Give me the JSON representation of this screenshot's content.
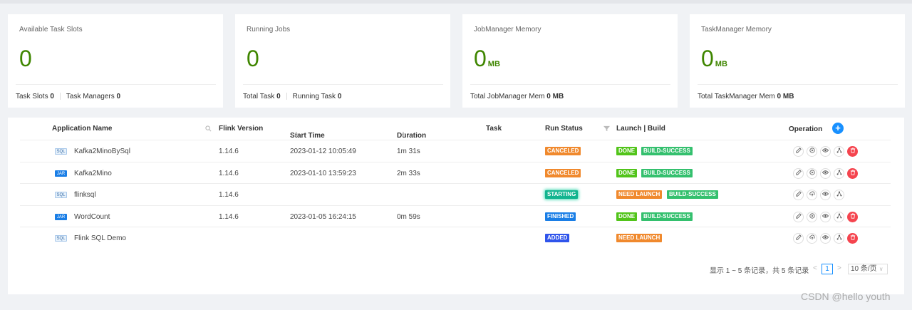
{
  "stats": [
    {
      "title": "Available Task Slots",
      "value": "0",
      "unit": "",
      "footer": [
        {
          "label": "Task Slots",
          "value": "0"
        },
        {
          "label": "Task Managers",
          "value": "0"
        }
      ]
    },
    {
      "title": "Running Jobs",
      "value": "0",
      "unit": "",
      "footer": [
        {
          "label": "Total Task",
          "value": "0"
        },
        {
          "label": "Running Task",
          "value": "0"
        }
      ]
    },
    {
      "title": "JobManager Memory",
      "value": "0",
      "unit": "MB",
      "footer": [
        {
          "label": "Total JobManager Mem",
          "value": "0 MB"
        }
      ]
    },
    {
      "title": "TaskManager Memory",
      "value": "0",
      "unit": "MB",
      "footer": [
        {
          "label": "Total TaskManager Mem",
          "value": "0 MB"
        }
      ]
    }
  ],
  "table": {
    "columns": {
      "name": "Application Name",
      "flink": "Flink Version",
      "start": "Start Time",
      "duration": "Duration",
      "task": "Task",
      "status": "Run Status",
      "launch": "Launch | Build",
      "operation": "Operation"
    },
    "add_icon": "+",
    "rows": [
      {
        "type": "SQL",
        "name": "Kafka2MinoBySql",
        "flink": "1.14.6",
        "start": "2023-01-12 10:05:49",
        "duration": "1m 31s",
        "status": "CANCELED",
        "launch": "DONE",
        "build": "BUILD-SUCCESS",
        "second_op": "play",
        "delete": true
      },
      {
        "type": "JAR",
        "name": "Kafka2Mino",
        "flink": "1.14.6",
        "start": "2023-01-10 13:59:23",
        "duration": "2m 33s",
        "status": "CANCELED",
        "launch": "DONE",
        "build": "BUILD-SUCCESS",
        "second_op": "play",
        "delete": true
      },
      {
        "type": "SQL",
        "name": "flinksql",
        "flink": "1.14.6",
        "start": "",
        "duration": "",
        "status": "STARTING",
        "launch": "NEED LAUNCH",
        "build": "BUILD-SUCCESS",
        "second_op": "upload",
        "delete": false
      },
      {
        "type": "JAR",
        "name": "WordCount",
        "flink": "1.14.6",
        "start": "2023-01-05 16:24:15",
        "duration": "0m 59s",
        "status": "FINISHED",
        "launch": "DONE",
        "build": "BUILD-SUCCESS",
        "second_op": "play",
        "delete": true
      },
      {
        "type": "SQL",
        "name": "Flink SQL Demo",
        "flink": "",
        "start": "",
        "duration": "",
        "status": "ADDED",
        "launch": "NEED LAUNCH",
        "build": "",
        "second_op": "upload",
        "delete": true
      }
    ]
  },
  "colors": {
    "CANCELED": "#f0892d",
    "STARTING": "#12b48f",
    "FINISHED": "#1a7ee6",
    "ADDED": "#2f54eb",
    "DONE": "#52c41a",
    "NEED LAUNCH": "#f0892d",
    "BUILD-SUCCESS": "#34c06e"
  },
  "pagination": {
    "summary": "显示 1 ~ 5 条记录，共 5 条记录",
    "prev": "<",
    "page": "1",
    "next": ">",
    "page_size": "10 条/页"
  },
  "watermark": "CSDN @hello youth"
}
